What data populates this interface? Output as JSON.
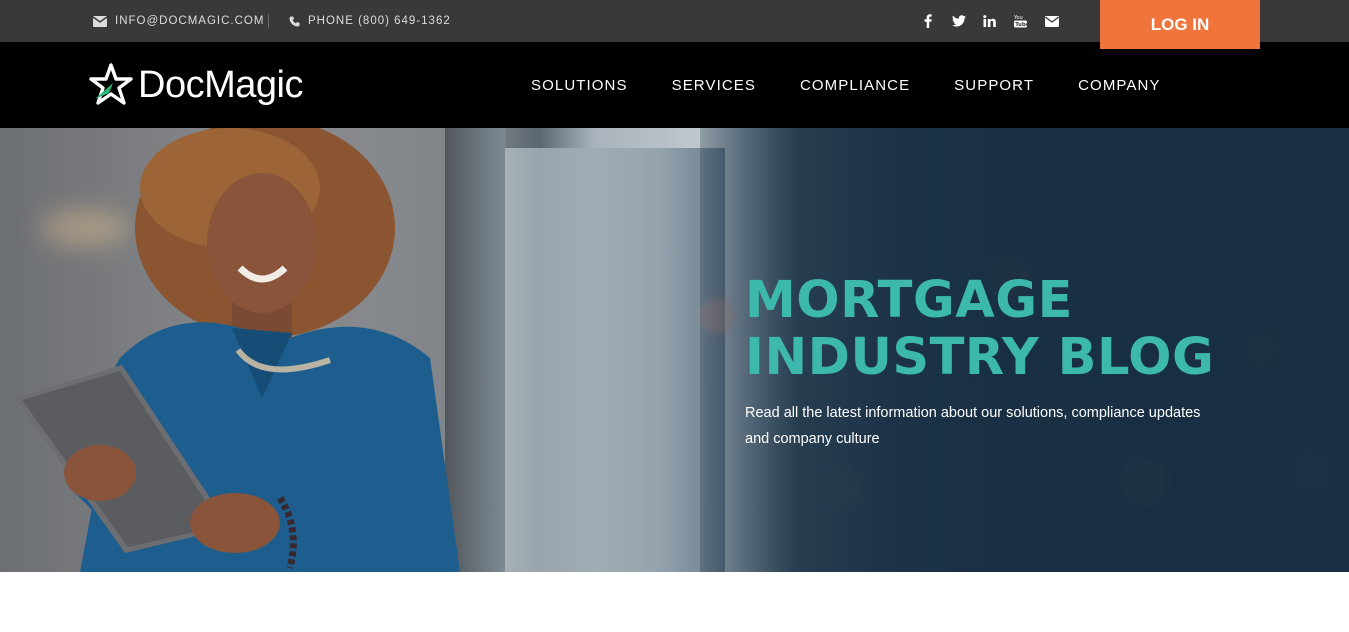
{
  "topbar": {
    "email_icon": "envelope-icon",
    "email": "INFO@DOCMAGIC.COM",
    "phone_icon": "phone-icon",
    "phone": "PHONE (800) 649-1362",
    "social": [
      {
        "icon": "facebook-icon",
        "glyph": "f"
      },
      {
        "icon": "twitter-icon",
        "glyph": "t"
      },
      {
        "icon": "linkedin-icon",
        "glyph": "in"
      },
      {
        "icon": "youtube-icon",
        "glyph": "yt"
      },
      {
        "icon": "mail-icon",
        "glyph": "mail"
      }
    ],
    "login_label": "LOG IN",
    "login_color": "#f0753c"
  },
  "navbar": {
    "logo_text": "DocMagic",
    "logo_accent": "#28b878",
    "items": [
      "SOLUTIONS",
      "SERVICES",
      "COMPLIANCE",
      "SUPPORT",
      "COMPANY"
    ]
  },
  "hero": {
    "title_line1": "MORTGAGE",
    "title_line2": "INDUSTRY BLOG",
    "subtitle": "Read all the latest information about our solutions, compliance updates and company culture",
    "title_color": "#3cb8ac"
  }
}
